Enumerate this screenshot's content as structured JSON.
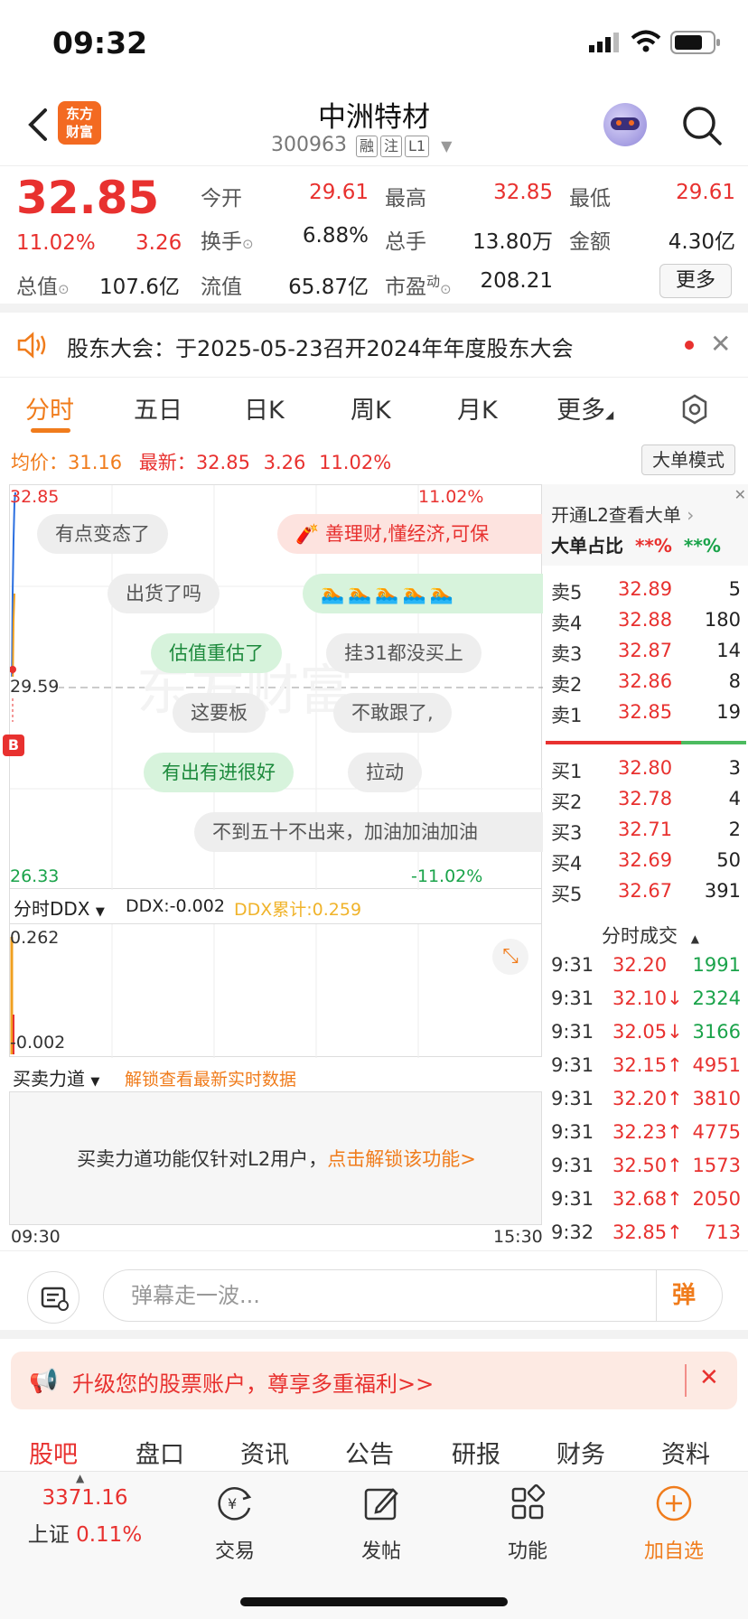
{
  "status": {
    "time": "09:32"
  },
  "header": {
    "logo_line1": "东方",
    "logo_line2": "财富",
    "title": "中洲特材",
    "code": "300963",
    "tags": [
      "融",
      "注",
      "L1"
    ]
  },
  "quote": {
    "price": "32.85",
    "pct": "11.02%",
    "chg": "3.26",
    "open_l": "今开",
    "open_v": "29.61",
    "high_l": "最高",
    "high_v": "32.85",
    "low_l": "最低",
    "low_v": "29.61",
    "turnover_l": "换手",
    "turnover_v": "6.88%",
    "volume_l": "总手",
    "volume_v": "13.80万",
    "amount_l": "金额",
    "amount_v": "4.30亿",
    "mcap_l": "总值",
    "mcap_v": "107.6亿",
    "float_l": "流值",
    "float_v": "65.87亿",
    "pe_l": "市盈",
    "pe_sup": "动",
    "pe_v": "208.21",
    "more": "更多"
  },
  "notice": {
    "text": "股东大会：于2025-05-23召开2024年年度股东大会"
  },
  "tabs": [
    "分时",
    "五日",
    "日K",
    "周K",
    "月K",
    "更多"
  ],
  "avgline": {
    "avg_l": "均价：",
    "avg_v": "31.16",
    "new_l": "最新：",
    "new_v": "32.85",
    "chg": "3.26",
    "pct": "11.02%",
    "mode": "大单模式"
  },
  "chart": {
    "top_price": "32.85",
    "top_pct": "11.02%",
    "mid_price": "29.59",
    "bottom_price": "26.33",
    "bottom_pct": "-11.02%",
    "b_marker": "B",
    "danmu": [
      "有点变态了",
      "善理财,懂经济,可保",
      "出货了吗",
      "估值重估了",
      "挂31都没买上",
      "这要板",
      "不敢跟了,",
      "有出有进很好",
      "拉动",
      "不到五十不出来，加油加油加油"
    ],
    "time_start": "09:30",
    "time_end": "15:30"
  },
  "ddx": {
    "selector": "分时DDX",
    "ddx": "DDX:-0.002",
    "ddx_cum": "DDX累计:0.259",
    "top": "0.262",
    "bottom": "-0.002"
  },
  "buysell": {
    "selector": "买卖力道",
    "unlock": "解锁查看最新实时数据",
    "msg": "买卖力道功能仅针对L2用户，",
    "msg_link": "点击解锁该功能>"
  },
  "orderbook": {
    "l2_title": "开通L2查看大单",
    "ratio_l": "大单占比",
    "ratio_a": "**%",
    "ratio_b": "**%",
    "asks": [
      {
        "k": "卖5",
        "p": "32.89",
        "v": "5"
      },
      {
        "k": "卖4",
        "p": "32.88",
        "v": "180"
      },
      {
        "k": "卖3",
        "p": "32.87",
        "v": "14"
      },
      {
        "k": "卖2",
        "p": "32.86",
        "v": "8"
      },
      {
        "k": "卖1",
        "p": "32.85",
        "v": "19"
      }
    ],
    "bids": [
      {
        "k": "买1",
        "p": "32.80",
        "v": "3"
      },
      {
        "k": "买2",
        "p": "32.78",
        "v": "4"
      },
      {
        "k": "买3",
        "p": "32.71",
        "v": "2"
      },
      {
        "k": "买4",
        "p": "32.69",
        "v": "50"
      },
      {
        "k": "买5",
        "p": "32.67",
        "v": "391"
      }
    ],
    "trades_title": "分时成交",
    "trades": [
      {
        "t": "9:31",
        "p": "32.20",
        "v": "1991"
      },
      {
        "t": "9:31",
        "p": "32.10↓",
        "v": "2324"
      },
      {
        "t": "9:31",
        "p": "32.05↓",
        "v": "3166"
      },
      {
        "t": "9:31",
        "p": "32.15↑",
        "v": "4951"
      },
      {
        "t": "9:31",
        "p": "32.20↑",
        "v": "3810"
      },
      {
        "t": "9:31",
        "p": "32.23↑",
        "v": "4775"
      },
      {
        "t": "9:31",
        "p": "32.50↑",
        "v": "1573"
      },
      {
        "t": "9:31",
        "p": "32.68↑",
        "v": "2050"
      },
      {
        "t": "9:32",
        "p": "32.85↑",
        "v": "713"
      }
    ]
  },
  "input": {
    "placeholder": "弹幕走一波...",
    "danmu_btn": "弹"
  },
  "promo": {
    "text": "升级您的股票账户，尊享多重福利>>"
  },
  "subtabs": [
    "股吧",
    "盘口",
    "资讯",
    "公告",
    "研报",
    "财务",
    "资料"
  ],
  "bottomnav": {
    "index_v": "3371.16",
    "index_l": "上证",
    "index_pct": "0.11%",
    "trade": "交易",
    "post": "发帖",
    "func": "功能",
    "addwatch": "加自选"
  },
  "colors": {
    "up": "#e8312f",
    "down": "#1aa34a",
    "accent": "#f07c1c"
  }
}
